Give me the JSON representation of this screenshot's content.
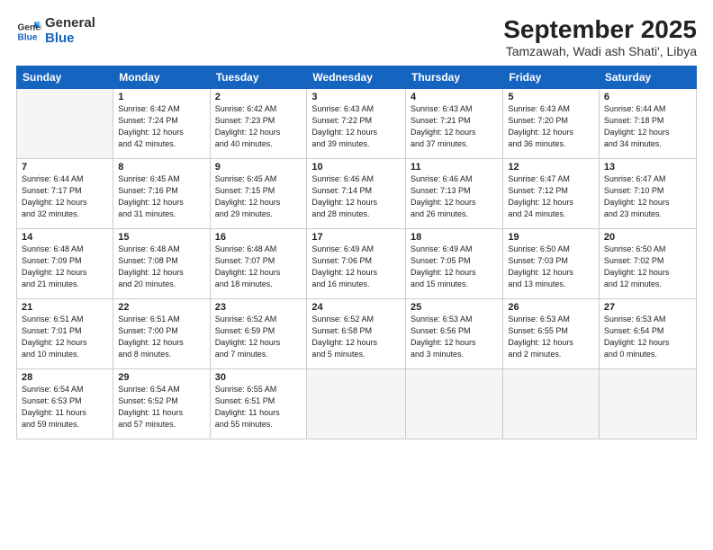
{
  "header": {
    "logo_general": "General",
    "logo_blue": "Blue",
    "month": "September 2025",
    "location": "Tamzawah, Wadi ash Shati', Libya"
  },
  "weekdays": [
    "Sunday",
    "Monday",
    "Tuesday",
    "Wednesday",
    "Thursday",
    "Friday",
    "Saturday"
  ],
  "weeks": [
    [
      {
        "day": "",
        "info": ""
      },
      {
        "day": "1",
        "info": "Sunrise: 6:42 AM\nSunset: 7:24 PM\nDaylight: 12 hours\nand 42 minutes."
      },
      {
        "day": "2",
        "info": "Sunrise: 6:42 AM\nSunset: 7:23 PM\nDaylight: 12 hours\nand 40 minutes."
      },
      {
        "day": "3",
        "info": "Sunrise: 6:43 AM\nSunset: 7:22 PM\nDaylight: 12 hours\nand 39 minutes."
      },
      {
        "day": "4",
        "info": "Sunrise: 6:43 AM\nSunset: 7:21 PM\nDaylight: 12 hours\nand 37 minutes."
      },
      {
        "day": "5",
        "info": "Sunrise: 6:43 AM\nSunset: 7:20 PM\nDaylight: 12 hours\nand 36 minutes."
      },
      {
        "day": "6",
        "info": "Sunrise: 6:44 AM\nSunset: 7:18 PM\nDaylight: 12 hours\nand 34 minutes."
      }
    ],
    [
      {
        "day": "7",
        "info": "Sunrise: 6:44 AM\nSunset: 7:17 PM\nDaylight: 12 hours\nand 32 minutes."
      },
      {
        "day": "8",
        "info": "Sunrise: 6:45 AM\nSunset: 7:16 PM\nDaylight: 12 hours\nand 31 minutes."
      },
      {
        "day": "9",
        "info": "Sunrise: 6:45 AM\nSunset: 7:15 PM\nDaylight: 12 hours\nand 29 minutes."
      },
      {
        "day": "10",
        "info": "Sunrise: 6:46 AM\nSunset: 7:14 PM\nDaylight: 12 hours\nand 28 minutes."
      },
      {
        "day": "11",
        "info": "Sunrise: 6:46 AM\nSunset: 7:13 PM\nDaylight: 12 hours\nand 26 minutes."
      },
      {
        "day": "12",
        "info": "Sunrise: 6:47 AM\nSunset: 7:12 PM\nDaylight: 12 hours\nand 24 minutes."
      },
      {
        "day": "13",
        "info": "Sunrise: 6:47 AM\nSunset: 7:10 PM\nDaylight: 12 hours\nand 23 minutes."
      }
    ],
    [
      {
        "day": "14",
        "info": "Sunrise: 6:48 AM\nSunset: 7:09 PM\nDaylight: 12 hours\nand 21 minutes."
      },
      {
        "day": "15",
        "info": "Sunrise: 6:48 AM\nSunset: 7:08 PM\nDaylight: 12 hours\nand 20 minutes."
      },
      {
        "day": "16",
        "info": "Sunrise: 6:48 AM\nSunset: 7:07 PM\nDaylight: 12 hours\nand 18 minutes."
      },
      {
        "day": "17",
        "info": "Sunrise: 6:49 AM\nSunset: 7:06 PM\nDaylight: 12 hours\nand 16 minutes."
      },
      {
        "day": "18",
        "info": "Sunrise: 6:49 AM\nSunset: 7:05 PM\nDaylight: 12 hours\nand 15 minutes."
      },
      {
        "day": "19",
        "info": "Sunrise: 6:50 AM\nSunset: 7:03 PM\nDaylight: 12 hours\nand 13 minutes."
      },
      {
        "day": "20",
        "info": "Sunrise: 6:50 AM\nSunset: 7:02 PM\nDaylight: 12 hours\nand 12 minutes."
      }
    ],
    [
      {
        "day": "21",
        "info": "Sunrise: 6:51 AM\nSunset: 7:01 PM\nDaylight: 12 hours\nand 10 minutes."
      },
      {
        "day": "22",
        "info": "Sunrise: 6:51 AM\nSunset: 7:00 PM\nDaylight: 12 hours\nand 8 minutes."
      },
      {
        "day": "23",
        "info": "Sunrise: 6:52 AM\nSunset: 6:59 PM\nDaylight: 12 hours\nand 7 minutes."
      },
      {
        "day": "24",
        "info": "Sunrise: 6:52 AM\nSunset: 6:58 PM\nDaylight: 12 hours\nand 5 minutes."
      },
      {
        "day": "25",
        "info": "Sunrise: 6:53 AM\nSunset: 6:56 PM\nDaylight: 12 hours\nand 3 minutes."
      },
      {
        "day": "26",
        "info": "Sunrise: 6:53 AM\nSunset: 6:55 PM\nDaylight: 12 hours\nand 2 minutes."
      },
      {
        "day": "27",
        "info": "Sunrise: 6:53 AM\nSunset: 6:54 PM\nDaylight: 12 hours\nand 0 minutes."
      }
    ],
    [
      {
        "day": "28",
        "info": "Sunrise: 6:54 AM\nSunset: 6:53 PM\nDaylight: 11 hours\nand 59 minutes."
      },
      {
        "day": "29",
        "info": "Sunrise: 6:54 AM\nSunset: 6:52 PM\nDaylight: 11 hours\nand 57 minutes."
      },
      {
        "day": "30",
        "info": "Sunrise: 6:55 AM\nSunset: 6:51 PM\nDaylight: 11 hours\nand 55 minutes."
      },
      {
        "day": "",
        "info": ""
      },
      {
        "day": "",
        "info": ""
      },
      {
        "day": "",
        "info": ""
      },
      {
        "day": "",
        "info": ""
      }
    ]
  ]
}
